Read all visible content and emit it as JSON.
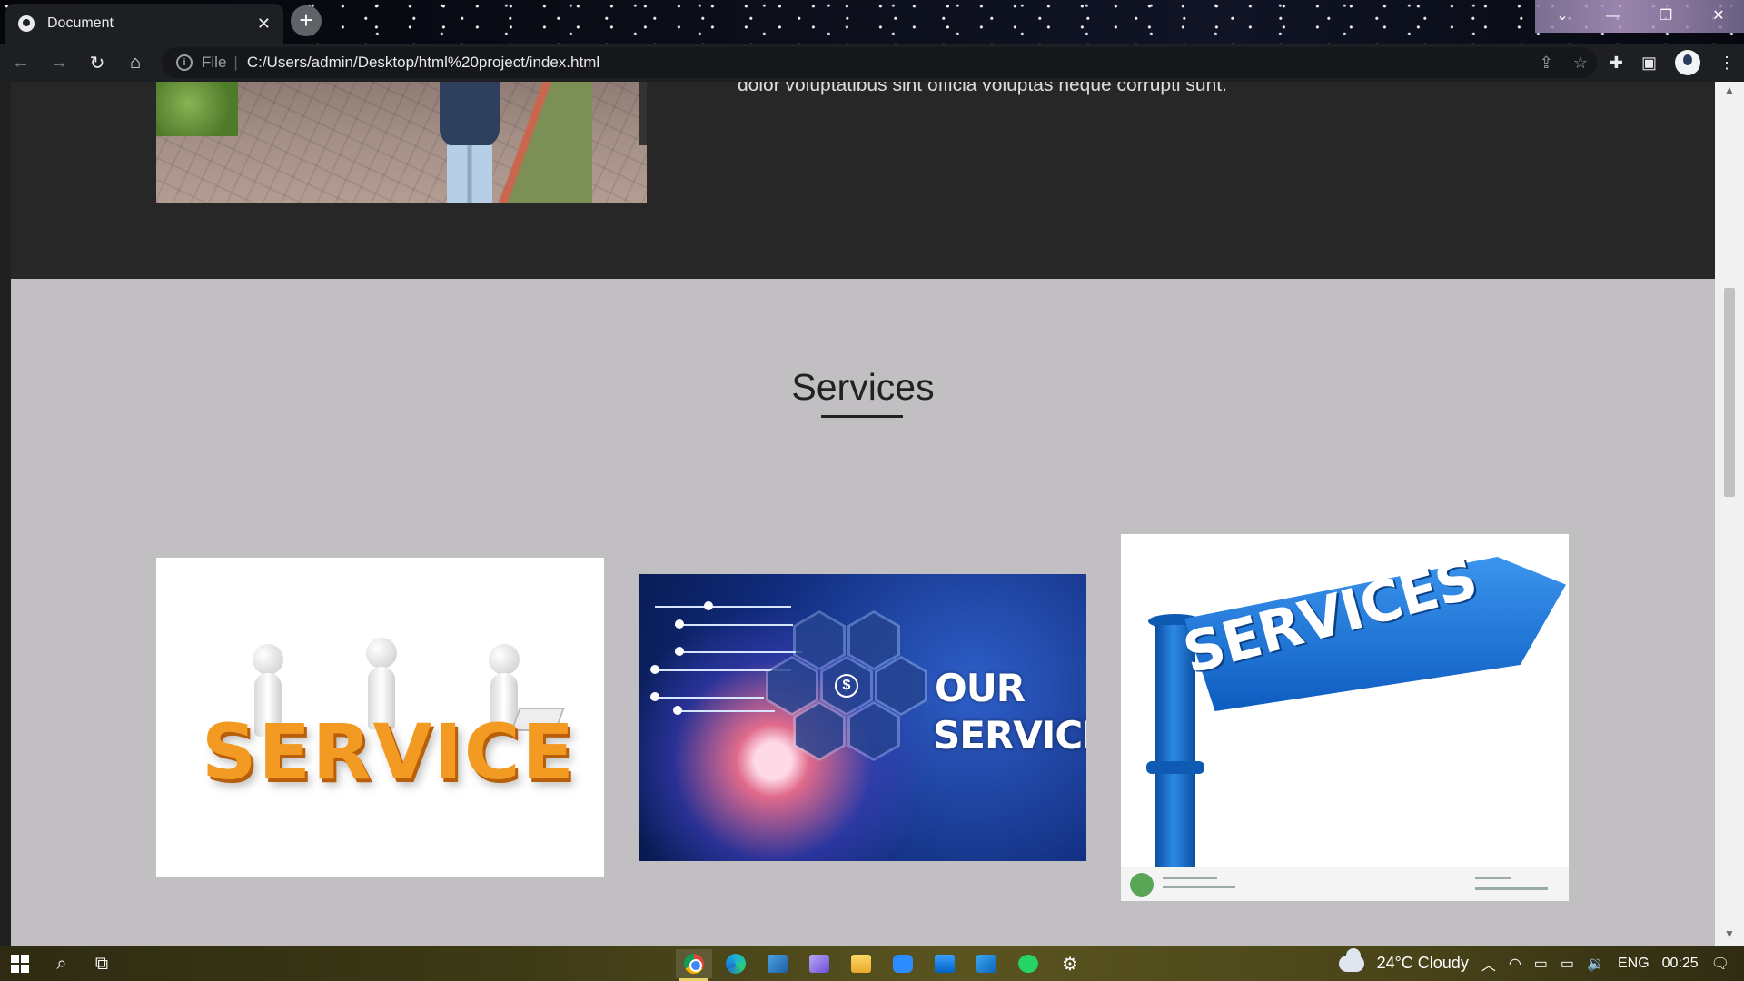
{
  "browser": {
    "tab_title": "Document",
    "tab_close": "✕",
    "new_tab": "+",
    "scheme_label": "File",
    "separator": "|",
    "url": "C:/Users/admin/Desktop/html%20project/index.html",
    "window_controls": {
      "chevron": "⌄",
      "minimize": "—",
      "restore": "❐",
      "close": "✕"
    }
  },
  "page": {
    "about_text_fragment": "dolor voluptatibus sint officia voluptas neque corrupti sunt.",
    "services": {
      "heading": "Services",
      "cards": [
        {
          "image": "service-3d-people",
          "word": "SERVICE"
        },
        {
          "image": "our-services-hexagons",
          "line1": "OUR",
          "line2": "SERVICES",
          "coin": "$"
        },
        {
          "image": "services-signpost",
          "word": "SERVICES"
        }
      ]
    }
  },
  "taskbar": {
    "weather": "24°C  Cloudy",
    "language": "ENG",
    "time": "00:25"
  },
  "colors": {
    "services_bg": "#c1bfc2",
    "about_bg": "#272727",
    "service_orange": "#f29a22",
    "sign_blue": "#1a73d9"
  },
  "icons": [
    "back-arrow-icon",
    "forward-arrow-icon",
    "reload-icon",
    "home-icon",
    "info-icon",
    "share-icon",
    "star-icon",
    "extensions-icon",
    "sidebar-icon",
    "profile-icon",
    "menu-icon"
  ]
}
